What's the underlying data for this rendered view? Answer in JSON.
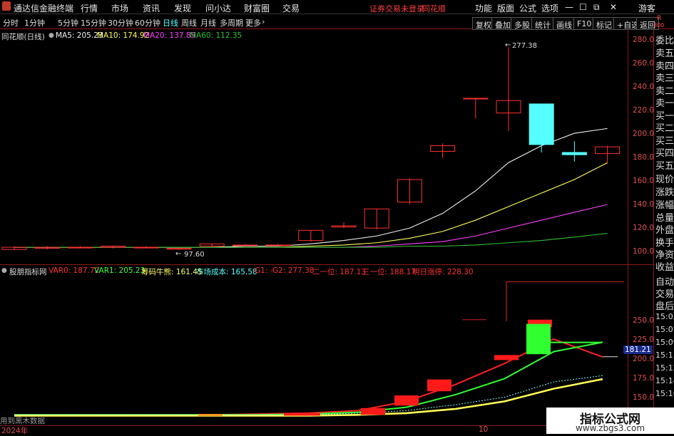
{
  "menu": {
    "app_title": "通达信金融终端",
    "items": [
      "行情",
      "市场",
      "资讯",
      "发现",
      "问小达",
      "财富圈",
      "交易"
    ],
    "notice": "证券交易未登录",
    "notice_broker": "同花顺",
    "right_items": [
      "功能",
      "版面",
      "公式",
      "选项"
    ],
    "user": "游客"
  },
  "periods": {
    "items": [
      "分时",
      "1分钟",
      "5分钟",
      "15分钟",
      "30分钟",
      "60分钟",
      "日线",
      "周线",
      "月线",
      "多周期",
      "更多"
    ],
    "active": "日线",
    "more_arrow": "›"
  },
  "toolbar": {
    "buttons": [
      "复权",
      "叠加",
      "多股",
      "统计",
      "画线",
      "F10",
      "标记",
      "+自选",
      "返回"
    ]
  },
  "corner": {
    "r": "R",
    "value": "300"
  },
  "main_legend": {
    "stock": "同花顺(日线)",
    "ma5": "MA5: 205.23",
    "ma10": "MA10: 174.92",
    "ma20": "MA20: 137.85",
    "ma60": "MA60: 112.35"
  },
  "sub_legend": {
    "name": "股朋指标网",
    "var0": "VAR0: 187.72",
    "var1": "VAR1: 205.23",
    "chip": "筹码牛熊: 161.45",
    "cost": "市场成本: 165.58",
    "g1": "G1: -",
    "g2": "G2: 277.38",
    "second": "二一位: 187.13",
    "third": "三一位: 188.17",
    "limit": "明日涨停: 228.30"
  },
  "annotations": {
    "high": "277.38",
    "low": "97.60",
    "current": "181.21"
  },
  "main_axis": [
    "280.0",
    "260.0",
    "240.0",
    "220.0",
    "200.0",
    "180.0",
    "160.0",
    "140.0",
    "120.0",
    "100.0"
  ],
  "sub_axis": [
    "250.0",
    "225.0",
    "200.0",
    "175.0",
    "150.0"
  ],
  "date_labels": {
    "year": "2024年",
    "month": "10"
  },
  "bottom_label": "用到黑木数据",
  "side_top": [
    "委比",
    "卖五",
    "卖四",
    "卖三",
    "卖二",
    "卖一",
    "买一",
    "买二",
    "买三",
    "买四",
    "买五",
    "现价",
    "涨跌",
    "涨幅",
    "总量",
    "外盘",
    "换手",
    "净资",
    "收益"
  ],
  "side_bottom": [
    "自动",
    "交易",
    "盘后",
    "15:05",
    "15:07",
    "15:09",
    "15:11",
    "15:12",
    "15:14",
    "15:16"
  ],
  "watermark": {
    "title": "指标公式网",
    "url": "www.zbgs3.com"
  },
  "colors": {
    "up": "#ff3030",
    "down": "#55ffff",
    "ma5": "#f0f0f0",
    "ma10": "#ffff55",
    "ma20": "#ff40ff",
    "ma60": "#30c030",
    "axis": "#e05050",
    "border": "#8b1a1a"
  },
  "chart_data": [
    {
      "type": "candlestick",
      "title": "同花顺(日线)",
      "ylim": [
        90,
        290
      ],
      "candles": [
        {
          "o": 98,
          "h": 101,
          "l": 97.6,
          "c": 100
        },
        {
          "o": 99,
          "h": 101,
          "l": 98,
          "c": 100
        },
        {
          "o": 100,
          "h": 101,
          "l": 99,
          "c": 100
        },
        {
          "o": 100,
          "h": 101.5,
          "l": 99,
          "c": 101
        },
        {
          "o": 100,
          "h": 101,
          "l": 99,
          "c": 100
        },
        {
          "o": 99,
          "h": 100,
          "l": 97.6,
          "c": 99
        },
        {
          "o": 101,
          "h": 103,
          "l": 100,
          "c": 103
        },
        {
          "o": 102,
          "h": 103,
          "l": 101,
          "c": 102
        },
        {
          "o": 102,
          "h": 103,
          "l": 101,
          "c": 102
        },
        {
          "o": 106,
          "h": 115,
          "l": 105,
          "c": 115
        },
        {
          "o": 118,
          "h": 122,
          "l": 117,
          "c": 119
        },
        {
          "o": 117,
          "h": 134,
          "l": 116,
          "c": 134
        },
        {
          "o": 140,
          "h": 161,
          "l": 138,
          "c": 160
        },
        {
          "o": 185,
          "h": 192,
          "l": 179,
          "c": 190
        },
        {
          "o": 232,
          "h": 232,
          "l": 214,
          "c": 232
        },
        {
          "o": 219,
          "h": 277.38,
          "l": 203,
          "c": 230
        },
        {
          "o": 227,
          "h": 227,
          "l": 184,
          "c": 191
        },
        {
          "o": 184,
          "h": 194,
          "l": 176,
          "c": 182
        },
        {
          "o": 183,
          "h": 190,
          "l": 174,
          "c": 189
        }
      ],
      "series": [
        {
          "name": "MA5",
          "values": [
            100,
            100,
            100,
            100,
            100,
            100,
            100,
            101,
            101,
            103,
            106,
            110,
            117,
            130,
            150,
            175,
            190,
            201,
            205.23
          ]
        },
        {
          "name": "MA10",
          "values": [
            100,
            100,
            100,
            100,
            100,
            100,
            100,
            100,
            100,
            101,
            102,
            104,
            108,
            114,
            124,
            136,
            148,
            160,
            174.92
          ]
        },
        {
          "name": "MA20",
          "values": [
            100,
            100,
            100,
            100,
            100,
            100,
            100,
            100,
            100,
            100,
            100,
            101,
            103,
            105,
            110,
            117,
            124,
            131,
            137.85
          ]
        },
        {
          "name": "MA60",
          "values": [
            100,
            100,
            100,
            100,
            100,
            100,
            100,
            100,
            100,
            100,
            100,
            100,
            101,
            101,
            102,
            104,
            106,
            109,
            112.35
          ]
        }
      ]
    },
    {
      "type": "bar",
      "title": "股朋指标网",
      "ylim": [
        115,
        280
      ],
      "blocks": [
        {
          "lo": 118,
          "hi": 120,
          "color": "orange"
        },
        {
          "lo": 118,
          "hi": 121,
          "color": "red"
        },
        {
          "lo": 118,
          "hi": 121,
          "color": "red"
        },
        {
          "lo": 119,
          "hi": 127,
          "color": "red"
        },
        {
          "lo": 130,
          "hi": 142,
          "color": "red"
        },
        {
          "lo": 147,
          "hi": 161,
          "color": "red"
        },
        {
          "lo": 184,
          "hi": 190,
          "color": "red"
        },
        {
          "lo": 223,
          "hi": 232,
          "color": "red"
        },
        {
          "lo": 191,
          "hi": 227,
          "color": "green"
        }
      ],
      "series": [
        {
          "name": "VAR0",
          "values": [
            119,
            119,
            119,
            119,
            119,
            120,
            121,
            124,
            135,
            155,
            180,
            209,
            187.72
          ]
        },
        {
          "name": "VAR1",
          "values": [
            119,
            119,
            119,
            119,
            119,
            119,
            120,
            122,
            128,
            143,
            162,
            194,
            205.23
          ]
        },
        {
          "name": "筹码牛熊",
          "values": [
            118,
            118,
            118,
            118,
            118,
            118,
            118,
            119,
            121,
            126,
            135,
            150,
            161.45
          ]
        },
        {
          "name": "市场成本",
          "values": [
            119,
            119,
            119,
            119,
            119,
            119,
            119,
            121,
            124,
            131,
            140,
            158,
            165.58
          ]
        }
      ]
    }
  ]
}
